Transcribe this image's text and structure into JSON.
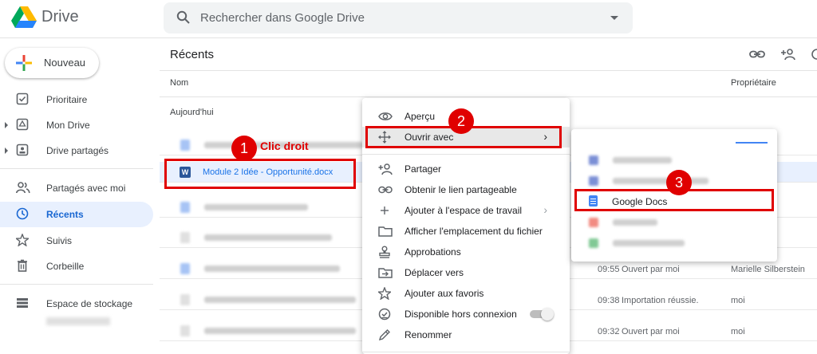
{
  "app": {
    "title": "Drive"
  },
  "search": {
    "placeholder": "Rechercher dans Google Drive"
  },
  "sidebar": {
    "new_label": "Nouveau",
    "items": [
      {
        "label": "Prioritaire",
        "icon": "priority-icon"
      },
      {
        "label": "Mon Drive",
        "icon": "my-drive-icon"
      },
      {
        "label": "Drive partagés",
        "icon": "shared-drives-icon"
      },
      {
        "label": "Partagés avec moi",
        "icon": "shared-with-me-icon"
      },
      {
        "label": "Récents",
        "icon": "recent-icon",
        "active": true
      },
      {
        "label": "Suivis",
        "icon": "star-icon"
      },
      {
        "label": "Corbeille",
        "icon": "trash-icon"
      },
      {
        "label": "Espace de stockage",
        "icon": "storage-icon"
      }
    ]
  },
  "main": {
    "title": "Récents",
    "columns": {
      "name": "Nom",
      "owner": "Propriétaire"
    },
    "group": "Aujourd'hui",
    "selected_file": "Module 2 Idée - Opportunité.docx",
    "rows": [
      {
        "time": "09:55",
        "activity": "Ouvert par moi",
        "owner": "Marielle Silberstein"
      },
      {
        "time": "09:38",
        "activity": "Importation réussie.",
        "owner": "moi"
      },
      {
        "time": "09:32",
        "activity": "Ouvert par moi",
        "owner": "moi"
      }
    ]
  },
  "context_menu": {
    "items": [
      {
        "label": "Aperçu",
        "icon": "eye-icon"
      },
      {
        "label": "Ouvrir avec",
        "icon": "move-icon",
        "submenu": true
      },
      {
        "label": "Partager",
        "icon": "add-person-icon"
      },
      {
        "label": "Obtenir le lien partageable",
        "icon": "link-icon"
      },
      {
        "label": "Ajouter à l'espace de travail",
        "icon": "plus-icon",
        "submenu": true
      },
      {
        "label": "Afficher l'emplacement du fichier",
        "icon": "folder-icon"
      },
      {
        "label": "Approbations",
        "icon": "stamp-icon"
      },
      {
        "label": "Déplacer vers",
        "icon": "move-to-icon"
      },
      {
        "label": "Ajouter aux favoris",
        "icon": "star-outline-icon"
      },
      {
        "label": "Disponible hors connexion",
        "icon": "offline-icon"
      },
      {
        "label": "Renommer",
        "icon": "pencil-icon"
      }
    ]
  },
  "submenu": {
    "google_docs": "Google Docs"
  },
  "annotations": {
    "step1": "1",
    "step1_label": "Clic droit",
    "step2": "2",
    "step3": "3"
  },
  "colors": {
    "accent": "#1a73e8",
    "highlight": "#e00000",
    "active_bg": "#e8f0fe"
  }
}
